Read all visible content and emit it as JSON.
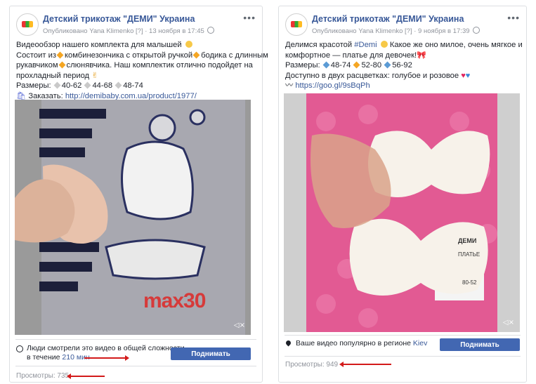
{
  "posts": [
    {
      "page_name": "Детский трикотаж \"ДЕМИ\" Украина",
      "published_prefix": "Опубликовано Yana Klimenko",
      "help_mark": "[?]",
      "date": "13 ноября в 17:45",
      "text": {
        "line1": "Видеообзор нашего комплекта для малышей",
        "line2a": "Состоит из",
        "line2b": "комбинезончика с открытой ручкой",
        "line2c": "бодика с длинным",
        "line3a": "рукавчиком",
        "line3b": "слюнявчика. Наш комплектик отлично подойдет на",
        "line4": "прохладный период",
        "sizes_label": "Размеры:",
        "sizes": [
          "40-62",
          "44-68",
          "48-74"
        ],
        "order_label": "Заказать:",
        "order_link": "http://demibaby.com.ua/product/1977/"
      },
      "stats_text_1": "Люди смотрели это видео в общей сложности",
      "stats_text_2": "в течение",
      "stats_minutes": "210 мин",
      "boost_label": "Поднимать публикацию",
      "views": "Просмотры: 735",
      "video_overlay_text": "max30"
    },
    {
      "page_name": "Детский трикотаж \"ДЕМИ\" Украина",
      "published_prefix": "Опубликовано Yana Klimenko",
      "help_mark": "[?]",
      "date": "9 ноября в 17:39",
      "text": {
        "line1a": "Делимся красотой",
        "hashtag": "#Demi",
        "line1b": "Какое же оно милое, очень мягкое и",
        "line2": "комфортное — платье для девочек!",
        "sizes_label": "Размеры:",
        "sizes": [
          "48-74",
          "52-80",
          "56-92"
        ],
        "colors_text": "Доступно в двух расцветках: голубое и розовое",
        "link": "https://goo.gl/9sBqPh"
      },
      "popular_text": "Ваше видео популярно в регионе",
      "region": "Kiev",
      "boost_label": "Поднимать публикацию",
      "views": "Просмотры: 949",
      "label_text_1": "ДЕМИ",
      "label_text_2": "ПЛАТЬЕ",
      "label_text_3": "80-52"
    }
  ],
  "colors": {
    "link": "#385898",
    "boost": "#4267b2",
    "arrow": "#d31a1a",
    "muted": "#90949c"
  },
  "icons": [
    "avatar-logo",
    "globe-icon",
    "more-icon",
    "mute-icon",
    "clock-icon",
    "location-pin-icon",
    "diamond-bullet-icon",
    "heart-icon"
  ]
}
